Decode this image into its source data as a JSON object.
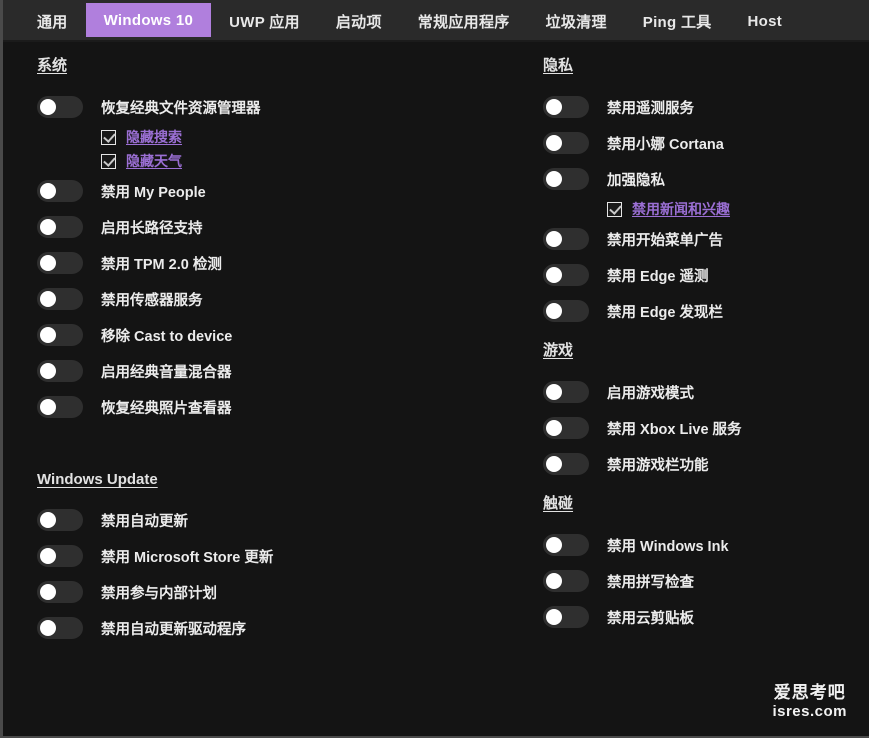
{
  "tabs": [
    {
      "label": "通用",
      "active": false
    },
    {
      "label": "Windows 10",
      "active": true
    },
    {
      "label": "UWP 应用",
      "active": false
    },
    {
      "label": "启动项",
      "active": false
    },
    {
      "label": "常规应用程序",
      "active": false
    },
    {
      "label": "垃圾清理",
      "active": false
    },
    {
      "label": "Ping 工具",
      "active": false
    },
    {
      "label": "Host",
      "active": false
    }
  ],
  "colors": {
    "accent": "#b07fdd",
    "link": "#9b6fd4",
    "tabbar_bg": "#2a2a2a",
    "content_bg": "#141414",
    "switch_off": "#2f2f2f",
    "knob": "#ffffff"
  },
  "left_column": {
    "sections": [
      {
        "title": "系统",
        "items": [
          {
            "label": "恢复经典文件资源管理器",
            "state": "off",
            "sub_items": [
              {
                "label": "隐藏搜索",
                "checked": true
              },
              {
                "label": "隐藏天气",
                "checked": true
              }
            ]
          },
          {
            "label": "禁用 My People",
            "state": "off",
            "sub_items": []
          },
          {
            "label": "启用长路径支持",
            "state": "off",
            "sub_items": []
          },
          {
            "label": "禁用 TPM 2.0 检测",
            "state": "off",
            "sub_items": []
          },
          {
            "label": "禁用传感器服务",
            "state": "off",
            "sub_items": []
          },
          {
            "label": "移除 Cast to device",
            "state": "off",
            "sub_items": []
          },
          {
            "label": "启用经典音量混合器",
            "state": "off",
            "sub_items": []
          },
          {
            "label": "恢复经典照片查看器",
            "state": "off",
            "sub_items": []
          }
        ]
      },
      {
        "title": "Windows Update",
        "items": [
          {
            "label": "禁用自动更新",
            "state": "off",
            "sub_items": []
          },
          {
            "label": "禁用 Microsoft Store 更新",
            "state": "off",
            "sub_items": []
          },
          {
            "label": "禁用参与内部计划",
            "state": "off",
            "sub_items": []
          },
          {
            "label": "禁用自动更新驱动程序",
            "state": "off",
            "sub_items": []
          }
        ]
      }
    ]
  },
  "right_column": {
    "sections": [
      {
        "title": "隐私",
        "items": [
          {
            "label": "禁用遥测服务",
            "state": "off",
            "sub_items": []
          },
          {
            "label": "禁用小娜 Cortana",
            "state": "off",
            "sub_items": []
          },
          {
            "label": "加强隐私",
            "state": "off",
            "sub_items": [
              {
                "label": "禁用新闻和兴趣",
                "checked": true
              }
            ]
          },
          {
            "label": "禁用开始菜单广告",
            "state": "off",
            "sub_items": []
          },
          {
            "label": "禁用 Edge 遥测",
            "state": "off",
            "sub_items": []
          },
          {
            "label": "禁用 Edge 发现栏",
            "state": "off",
            "sub_items": []
          }
        ]
      },
      {
        "title": "游戏",
        "items": [
          {
            "label": "启用游戏模式",
            "state": "off",
            "sub_items": []
          },
          {
            "label": "禁用 Xbox Live 服务",
            "state": "off",
            "sub_items": []
          },
          {
            "label": "禁用游戏栏功能",
            "state": "off",
            "sub_items": []
          }
        ]
      },
      {
        "title": "触碰",
        "items": [
          {
            "label": "禁用 Windows Ink",
            "state": "off",
            "sub_items": []
          },
          {
            "label": "禁用拼写检查",
            "state": "off",
            "sub_items": []
          },
          {
            "label": "禁用云剪贴板",
            "state": "off",
            "sub_items": []
          }
        ]
      }
    ]
  },
  "watermark": {
    "cn": "爱思考吧",
    "en": "isres.com"
  }
}
